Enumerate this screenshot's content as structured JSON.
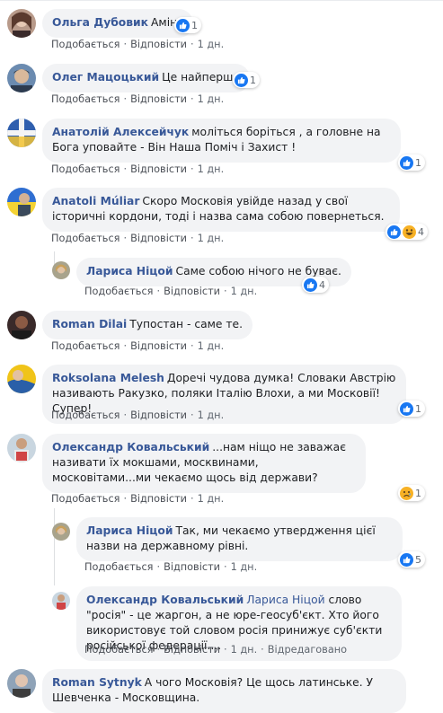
{
  "actions": {
    "like": "Подобається",
    "reply": "Відповісти",
    "edited": "Відредаговано"
  },
  "comments": [
    {
      "author": "Ольга Дубовик",
      "text": "Амінь",
      "time": "1 дн.",
      "reactions": "1"
    },
    {
      "author": "Олег Мацоцький",
      "text": "Це найперше",
      "time": "1 дн.",
      "reactions": "1"
    },
    {
      "author": "Анатолій Алексейчук",
      "text": "моліться боріться , а головне на Бога уповайте - Він Наша Поміч і Захист !",
      "time": "1 дн.",
      "reactions": "1"
    },
    {
      "author": "Anatoli Múliar",
      "text": "Скоро Московія увійде назад у свої історичні кордони, тоді і назва сама собою повернеться.",
      "time": "1 дн.",
      "reactions": "4"
    },
    {
      "author": "Лариса Ніцой",
      "text": "Саме собою нічого не буває.",
      "time": "1 дн.",
      "reactions": "4"
    },
    {
      "author": "Roman Dilai",
      "text": "Тупостан - саме те.",
      "time": "1 дн."
    },
    {
      "author": "Roksolana Melesh",
      "text": "Доречі чудова думка! Словаки Австрію називають Ракузко, поляки Італію Влохи, а ми Московії! Супер!",
      "time": "1 дн.",
      "reactions": "1"
    },
    {
      "author": "Олександр Ковальський",
      "text": "...нам ніщо не заважає називати їх мокшами, москвинами, московітами...ми чекаємо щось від держави?",
      "time": "1 дн.",
      "reactions": "1"
    },
    {
      "author": "Лариса Ніцой",
      "text": "Так, ми чекаємо утвердження цієї назви на державному рівні.",
      "time": "1 дн.",
      "reactions": "5"
    },
    {
      "author": "Олександр Ковальський",
      "mention": "Лариса Ніцой",
      "text": "слово \"росія\" - це жаргон, а не юре-геосуб'єкт. Хто його використовує той словом росія принижує суб'єкти російської федерації....",
      "time": "1 дн."
    },
    {
      "author": "Roman Sytnyk",
      "text": "А чого Московія? Це щось латинське. У Шевченка - Московщина."
    }
  ]
}
